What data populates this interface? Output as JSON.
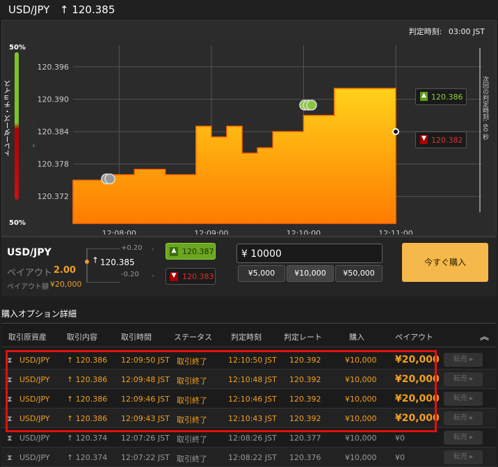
{
  "header": {
    "pair": "USD/JPY",
    "rate": "↑ 120.385"
  },
  "chart_panel": {
    "judge_label": "判定時刻:",
    "judge_time": "03:00 JST",
    "trader_choice_label": "トレーダーズ・チョイス",
    "trader_top": "50%",
    "trader_bottom": "50%",
    "countdown_label": "次回の判定時刻: 60 秒",
    "high_tag": "120.386",
    "low_tag": "120.382"
  },
  "chart_data": {
    "type": "area",
    "x": [
      "12:07:30",
      "12:07:40",
      "12:07:50",
      "12:08:00",
      "12:08:10",
      "12:08:20",
      "12:08:30",
      "12:08:40",
      "12:08:50",
      "12:09:00",
      "12:09:10",
      "12:09:20",
      "12:09:30",
      "12:09:40",
      "12:09:50",
      "12:10:00",
      "12:10:10",
      "12:10:20",
      "12:10:30",
      "12:10:40",
      "12:10:50",
      "12:11:00"
    ],
    "values": [
      120.375,
      120.375,
      120.376,
      120.376,
      120.377,
      120.377,
      120.376,
      120.376,
      120.385,
      120.383,
      120.385,
      120.38,
      120.381,
      120.384,
      120.384,
      120.387,
      120.387,
      120.392,
      120.392,
      120.392,
      120.392,
      120.384
    ],
    "xticks": [
      "12:08:00",
      "12:09:00",
      "12:10:00",
      "12:11:00"
    ],
    "yticks": [
      "120.396",
      "120.390",
      "120.384",
      "120.378",
      "120.372"
    ],
    "ylim": [
      120.367,
      120.4
    ],
    "grid": true
  },
  "order": {
    "pair": "USD/JPY",
    "payout_label": "ペイアウト",
    "payout_value": "2.00",
    "payout_amount_label": "ペイアウト額",
    "payout_amount": "¥20,000",
    "up_offset": "+0.20",
    "down_offset": "-0.20",
    "current_rate": "120.385",
    "high_rate": "120.387",
    "low_rate": "120.383",
    "amount_input": "¥ 10000",
    "preset_1": "¥5,000",
    "preset_2": "¥10,000",
    "preset_3": "¥50,000",
    "buy_button": "今すぐ購入"
  },
  "details": {
    "title": "購入オプション詳細",
    "columns": [
      "取引原資産",
      "取引内容",
      "取引時間",
      "ステータス",
      "判定時刻",
      "判定レート",
      "購入",
      "ペイアウト"
    ],
    "rows": [
      {
        "asset": "USD/JPY",
        "trade": "120.386",
        "time": "12:09:50 JST",
        "status": "取引終了",
        "judge": "12:10:50 JST",
        "rate": "120.392",
        "buy": "¥10,000",
        "payout": "¥20,000",
        "sell": "転売"
      },
      {
        "asset": "USD/JPY",
        "trade": "120.386",
        "time": "12:09:48 JST",
        "status": "取引終了",
        "judge": "12:10:48 JST",
        "rate": "120.392",
        "buy": "¥10,000",
        "payout": "¥20,000",
        "sell": "転売"
      },
      {
        "asset": "USD/JPY",
        "trade": "120.386",
        "time": "12:09:46 JST",
        "status": "取引終了",
        "judge": "12:10:46 JST",
        "rate": "120.392",
        "buy": "¥10,000",
        "payout": "¥20,000",
        "sell": "転売"
      },
      {
        "asset": "USD/JPY",
        "trade": "120.386",
        "time": "12:09:43 JST",
        "status": "取引終了",
        "judge": "12:10:43 JST",
        "rate": "120.392",
        "buy": "¥10,000",
        "payout": "¥20,000",
        "sell": "転売"
      },
      {
        "asset": "USD/JPY",
        "trade": "120.374",
        "time": "12:07:26 JST",
        "status": "取引終了",
        "judge": "12:08:26 JST",
        "rate": "120.377",
        "buy": "¥10,000",
        "payout": "¥0",
        "sell": "転売"
      },
      {
        "asset": "USD/JPY",
        "trade": "120.374",
        "time": "12:07:22 JST",
        "status": "取引終了",
        "judge": "12:08:22 JST",
        "rate": "120.376",
        "buy": "¥10,000",
        "payout": "¥0",
        "sell": "転売"
      }
    ]
  }
}
